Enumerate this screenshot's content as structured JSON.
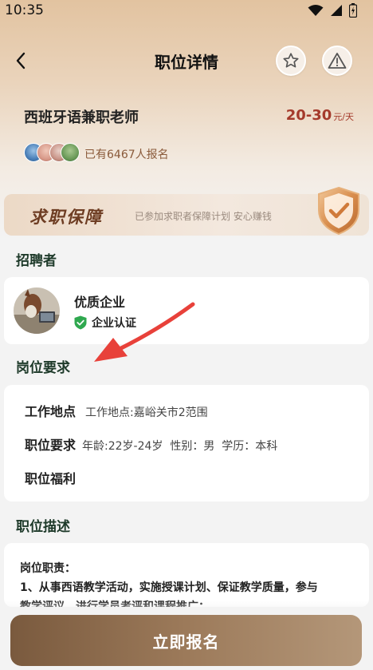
{
  "status_bar": {
    "time": "10:35"
  },
  "nav": {
    "title": "职位详情"
  },
  "job": {
    "title": "西班牙语兼职老师",
    "salary": "20-30",
    "salary_unit": "元/天",
    "applied": "已有6467人报名"
  },
  "guarantee": {
    "title": "求职保障",
    "subtitle": "已参加求职者保障计划 安心赚钱"
  },
  "recruiter": {
    "section_title": "招聘者",
    "company_name": "优质企业",
    "verified_label": "企业认证"
  },
  "requirements": {
    "section_title": "岗位要求",
    "rows": [
      {
        "label": "工作地点",
        "value": "工作地点:嘉峪关市2范围"
      },
      {
        "label": "职位要求",
        "value": "年龄:22岁-24岁  性别：男  学历：本科"
      },
      {
        "label": "职位福利",
        "value": ""
      }
    ]
  },
  "description": {
    "section_title": "职位描述",
    "line1": "岗位职责：",
    "line2": "1、从事西语教学活动，实施授课计划、保证教学质量，参与",
    "line3": "教学评议，进行学员考评和课程推广；"
  },
  "apply_button": {
    "label": "立即报名"
  },
  "colors": {
    "salary": "#a43a2b",
    "verified": "#2fa84f",
    "apply_gradient_start": "#7a5a3e",
    "apply_gradient_end": "#b49779",
    "arrow": "#e8413a"
  },
  "icons": [
    "wifi-icon",
    "signal-icon",
    "battery-icon",
    "back-arrow-icon",
    "star-icon",
    "warning-icon",
    "shield-check-icon",
    "verified-shield-icon"
  ]
}
